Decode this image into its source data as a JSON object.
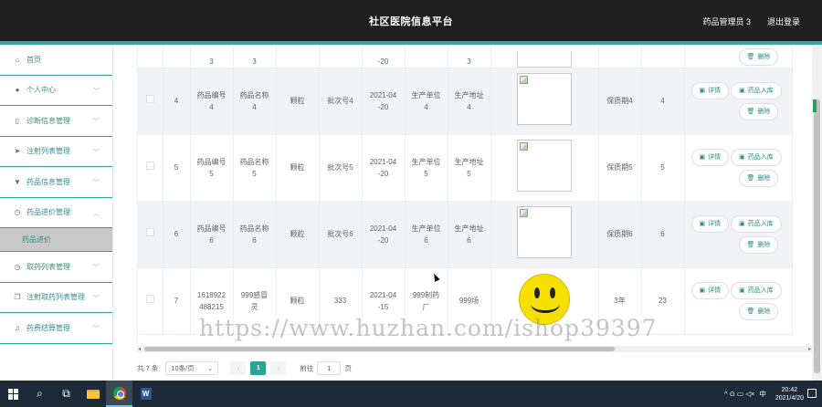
{
  "header": {
    "title": "社区医院信息平台",
    "user": "药品管理员 3",
    "logout": "退出登录"
  },
  "sidebar": {
    "items": [
      {
        "label": "首页",
        "icon": "home-icon",
        "glyph": "⌂"
      },
      {
        "label": "个人中心",
        "icon": "user-icon",
        "glyph": "●"
      },
      {
        "label": "诊断信息管理",
        "icon": "phone-icon",
        "glyph": "▯"
      },
      {
        "label": "注射列表管理",
        "icon": "send-icon",
        "glyph": "➤"
      },
      {
        "label": "药品信息管理",
        "icon": "medicine-icon",
        "glyph": "▼"
      },
      {
        "label": "药品进价管理",
        "icon": "clock-icon",
        "glyph": "◷"
      },
      {
        "label": "取药列表管理",
        "icon": "clock-icon",
        "glyph": "◷"
      },
      {
        "label": "注射取药列表管理",
        "icon": "copy-icon",
        "glyph": "❐"
      },
      {
        "label": "药费结算管理",
        "icon": "mic-icon",
        "glyph": "♫"
      }
    ],
    "submenu": {
      "label": "药品进价"
    }
  },
  "table": {
    "partial_row": {
      "c2": "3",
      "c3": "3",
      "c6": "-20",
      "c8": "3"
    },
    "rows": [
      {
        "idx": "4",
        "code": [
          "药品编号",
          "4"
        ],
        "name": [
          "药品名称",
          "4"
        ],
        "form": "颗粒",
        "batch": "批次号4",
        "date": [
          "2021-04",
          "-20"
        ],
        "unit": [
          "生产单位",
          "4"
        ],
        "addr": [
          "生产地址",
          "4"
        ],
        "img": "broken",
        "shelf": "保质期4",
        "qty": "4",
        "ops": "three"
      },
      {
        "idx": "5",
        "code": [
          "药品编号",
          "5"
        ],
        "name": [
          "药品名称",
          "5"
        ],
        "form": "颗粒",
        "batch": "批次号5",
        "date": [
          "2021-04",
          "-20"
        ],
        "unit": [
          "生产单位",
          "5"
        ],
        "addr": [
          "生产地址",
          "5"
        ],
        "img": "broken",
        "shelf": "保质期5",
        "qty": "5",
        "ops": "three"
      },
      {
        "idx": "6",
        "code": [
          "药品编号",
          "6"
        ],
        "name": [
          "药品名称",
          "6"
        ],
        "form": "颗粒",
        "batch": "批次号6",
        "date": [
          "2021-04",
          "-20"
        ],
        "unit": [
          "生产单位",
          "6"
        ],
        "addr": [
          "生产地址",
          "6"
        ],
        "img": "broken",
        "shelf": "保质期6",
        "qty": "6",
        "ops": "three"
      },
      {
        "idx": "7",
        "code": [
          "1618922",
          "488215"
        ],
        "name": [
          "999感冒",
          "灵"
        ],
        "form": "颗粒",
        "batch": "333",
        "date": [
          "2021-04",
          "-15"
        ],
        "unit": [
          "999制药",
          "厂"
        ],
        "addr": [
          "999场",
          ""
        ],
        "img": "smiley",
        "shelf": "3年",
        "qty": "23",
        "ops": "three"
      }
    ],
    "buttons": {
      "detail": "详情",
      "stock_in": "药品入库",
      "delete": "删除"
    }
  },
  "pagination": {
    "total": "共 7 条",
    "page_size": "10条/页",
    "current_page": "1",
    "goto_label": "前往",
    "goto_value": "1",
    "page_suffix": "页"
  },
  "watermark": "https://www.huzhan.com/ishop39397",
  "taskbar": {
    "time": "20:42",
    "date": "2021/4/20",
    "ime": "中",
    "search_glyph": "⌕",
    "taskview_glyph": "⧉",
    "word_glyph": "W",
    "tray_icons": "^ ⊙ ▭ ◁× "
  }
}
